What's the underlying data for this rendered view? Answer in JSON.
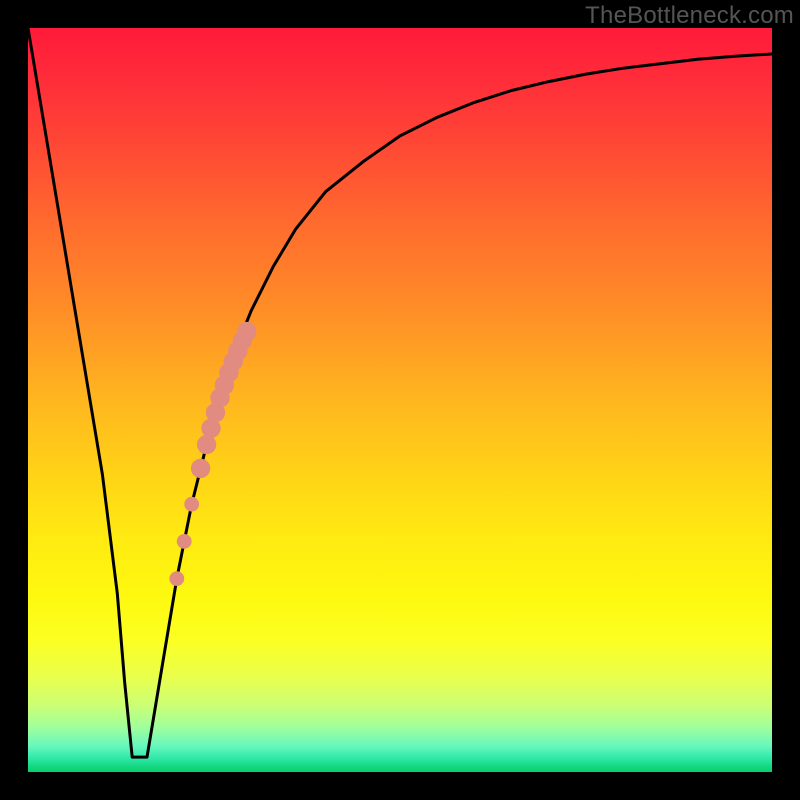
{
  "watermark": "TheBottleneck.com",
  "colors": {
    "frame": "#000000",
    "curve": "#000000",
    "marker": "#e28b80",
    "gradient_top": "#ff1a3a",
    "gradient_bottom": "#07cf6c"
  },
  "chart_data": {
    "type": "line",
    "title": "",
    "xlabel": "",
    "ylabel": "",
    "xlim": [
      0,
      100
    ],
    "ylim": [
      0,
      100
    ],
    "grid": false,
    "legend": false,
    "series": [
      {
        "name": "bottleneck-curve",
        "x": [
          0,
          2,
          4,
          6,
          8,
          10,
          12,
          13,
          14,
          16,
          18,
          20,
          22,
          24,
          26,
          28,
          30,
          33,
          36,
          40,
          45,
          50,
          55,
          60,
          65,
          70,
          75,
          80,
          85,
          90,
          95,
          100
        ],
        "y": [
          100,
          88,
          76,
          64,
          52,
          40,
          24,
          12,
          2,
          2,
          14,
          26,
          36,
          44,
          51,
          57,
          62,
          68,
          73,
          78,
          82,
          85.5,
          88,
          90,
          91.6,
          92.8,
          93.8,
          94.6,
          95.2,
          95.8,
          96.2,
          96.5
        ]
      }
    ],
    "markers": [
      {
        "name": "highlight-segment",
        "shape": "circle",
        "color": "#e28b80",
        "points": [
          {
            "x": 20.0,
            "y": 26.0,
            "r": 1.0
          },
          {
            "x": 21.0,
            "y": 31.0,
            "r": 1.0
          },
          {
            "x": 22.0,
            "y": 36.0,
            "r": 1.0
          },
          {
            "x": 23.2,
            "y": 40.8,
            "r": 1.3
          },
          {
            "x": 24.0,
            "y": 44.0,
            "r": 1.3
          },
          {
            "x": 24.6,
            "y": 46.2,
            "r": 1.3
          },
          {
            "x": 25.2,
            "y": 48.3,
            "r": 1.3
          },
          {
            "x": 25.8,
            "y": 50.3,
            "r": 1.3
          },
          {
            "x": 26.4,
            "y": 52.0,
            "r": 1.3
          },
          {
            "x": 27.0,
            "y": 53.7,
            "r": 1.3
          },
          {
            "x": 27.6,
            "y": 55.2,
            "r": 1.3
          },
          {
            "x": 28.2,
            "y": 56.6,
            "r": 1.3
          },
          {
            "x": 28.8,
            "y": 58.0,
            "r": 1.3
          },
          {
            "x": 29.4,
            "y": 59.2,
            "r": 1.3
          }
        ]
      }
    ]
  }
}
